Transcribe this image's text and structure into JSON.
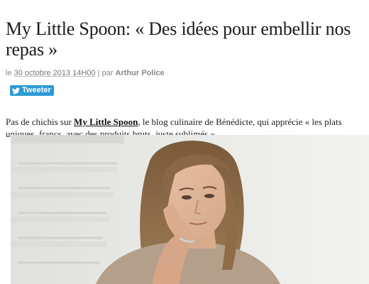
{
  "article": {
    "title": "My Little Spoon: « Des idées pour embellir nos repas »",
    "byline": {
      "prefix": "le ",
      "date": "30 octobre 2013 14H00",
      "separator": " | par ",
      "author": "Arthur Police"
    },
    "tweet_button": {
      "label": "Tweeter",
      "icon": "twitter-bird-icon"
    },
    "intro": {
      "before": "Pas de chichis sur ",
      "link": "My Little Spoon",
      "after": ", le blog culinaire de Bénédicte, qui apprécie « les plats uniques, francs, avec des produits bruts, juste sublimés »."
    }
  },
  "colors": {
    "tweet_bg": "#2b9bd3",
    "byline": "#888888",
    "title": "#1a1a1a"
  }
}
